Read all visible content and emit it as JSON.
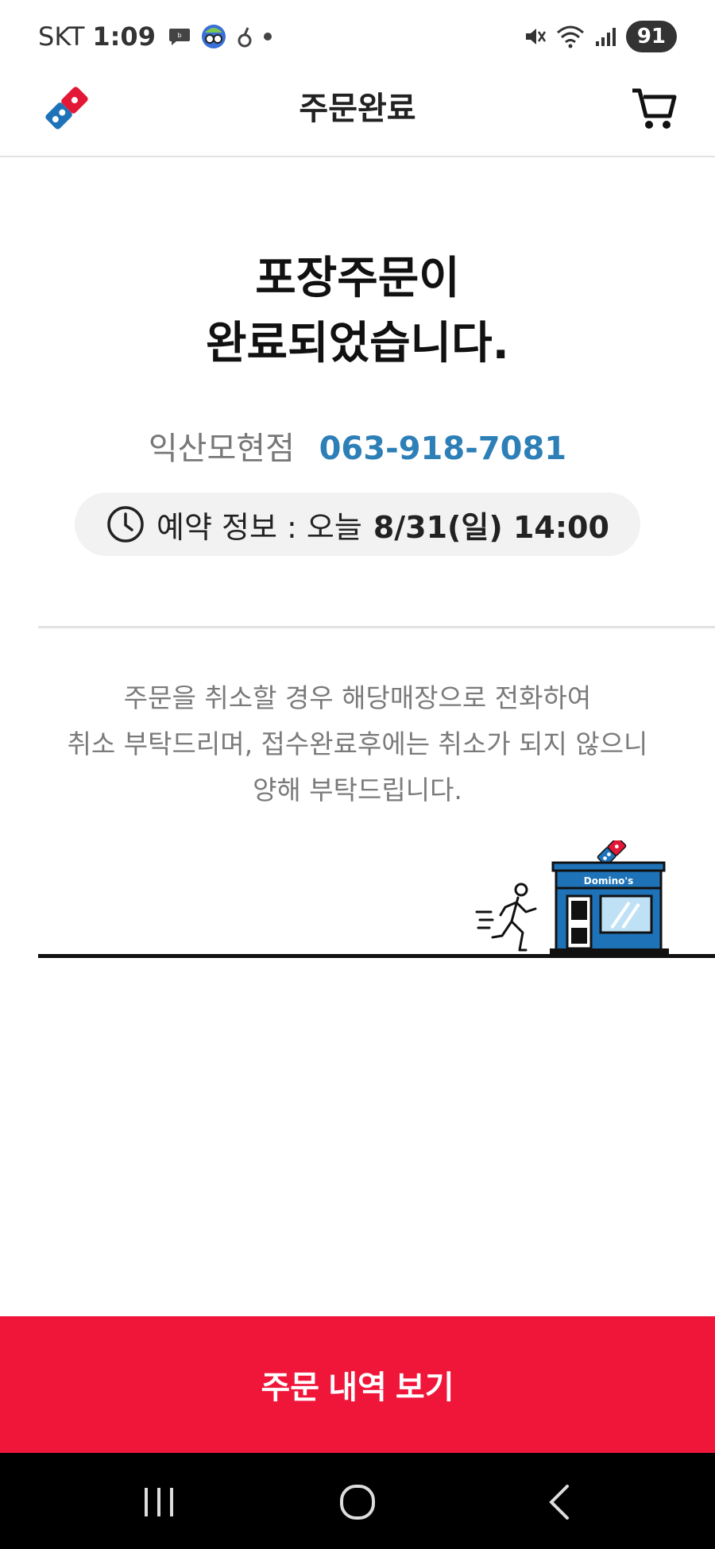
{
  "status_bar": {
    "carrier": "SKT",
    "time": "1:09",
    "battery": "91"
  },
  "header": {
    "title": "주문완료",
    "logo_icon": "dominos-logo-icon",
    "cart_icon": "cart-icon"
  },
  "main": {
    "headline_line1": "포장주문이",
    "headline_line2": "완료되었습니다.",
    "store_name": "익산모현점",
    "store_phone": "063-918-7081",
    "reservation_label": "예약 정보 : 오늘",
    "reservation_datetime": "8/31(일) 14:00",
    "notice_line1": "주문을 취소할 경우 해당매장으로 전화하여",
    "notice_line2": "취소 부탁드리며, 접수완료후에는 취소가 되지 않으니",
    "notice_line3": "양해 부탁드립니다.",
    "store_sign": "Domino's"
  },
  "footer": {
    "order_history_label": "주문 내역 보기"
  },
  "colors": {
    "accent_red": "#f0163a",
    "phone_blue": "#2d7fb8",
    "dominos_blue": "#1e73b8",
    "dominos_red": "#e31837"
  }
}
